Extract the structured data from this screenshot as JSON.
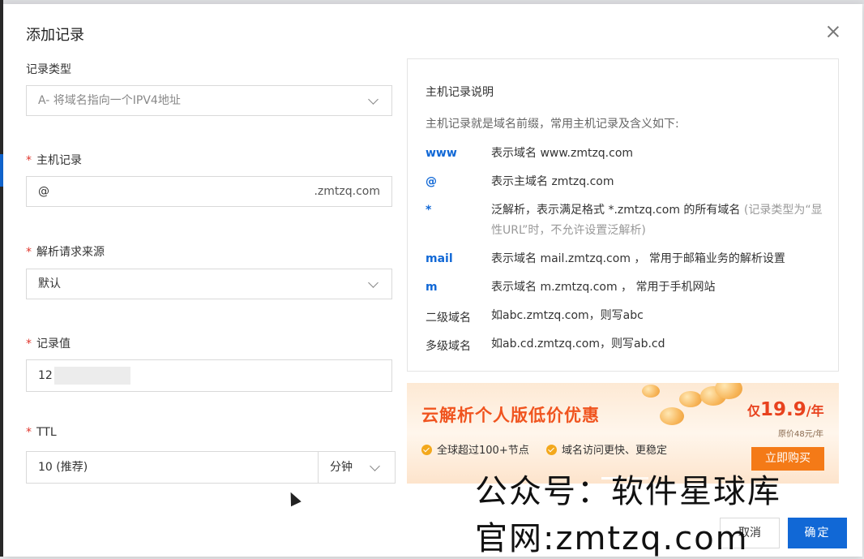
{
  "dialog": {
    "title": "添加记录"
  },
  "form": {
    "record_type": {
      "label": "记录类型",
      "value": "A- 将域名指向一个IPV4地址"
    },
    "host_record": {
      "required_mark": "*",
      "label": "主机记录",
      "value": "@",
      "suffix": ".zmtzq.com"
    },
    "resolve_source": {
      "required_mark": "*",
      "label": "解析请求来源",
      "value": "默认"
    },
    "record_value": {
      "required_mark": "*",
      "label": "记录值",
      "value": "12"
    },
    "ttl": {
      "required_mark": "*",
      "label": "TTL",
      "value": "10 (推荐)",
      "unit": "分钟"
    }
  },
  "info": {
    "title": "主机记录说明",
    "intro": "主机记录就是域名前缀，常用主机记录及含义如下:",
    "rows": [
      {
        "key": "www",
        "desc": "表示域名 www.zmtzq.com"
      },
      {
        "key": "@",
        "desc": "表示主域名 zmtzq.com"
      },
      {
        "key": "*",
        "desc": "泛解析，表示满足格式 *.zmtzq.com 的所有域名",
        "note": "(记录类型为“显性URL”时，不允许设置泛解析)"
      },
      {
        "key": "mail",
        "desc": "表示域名 mail.zmtzq.com ， 常用于邮箱业务的解析设置"
      },
      {
        "key": "m",
        "desc": "表示域名 m.zmtzq.com ， 常用于手机网站"
      },
      {
        "key": "二级域名",
        "desc": "如abc.zmtzq.com，则写abc"
      },
      {
        "key": "多级域名",
        "desc": "如ab.cd.zmtzq.com，则写ab.cd"
      }
    ]
  },
  "banner": {
    "title": "云解析个人版低价优惠",
    "price_prefix": "仅",
    "price": "19.9",
    "price_unit": "/年",
    "original_price": "原价48元/年",
    "features": [
      "全球超过100+节点",
      "域名访问更快、更稳定"
    ],
    "buy_label": "立即购买"
  },
  "watermark": {
    "line1": "公众号：软件星球库",
    "line2": "官网:zmtzq.com"
  },
  "footer": {
    "cancel_label": "取消",
    "ok_label": "确定"
  },
  "colors": {
    "primary": "#1168d6",
    "required": "#e0372e",
    "banner_accent": "#f0541f",
    "buy_button": "#f47a17"
  }
}
